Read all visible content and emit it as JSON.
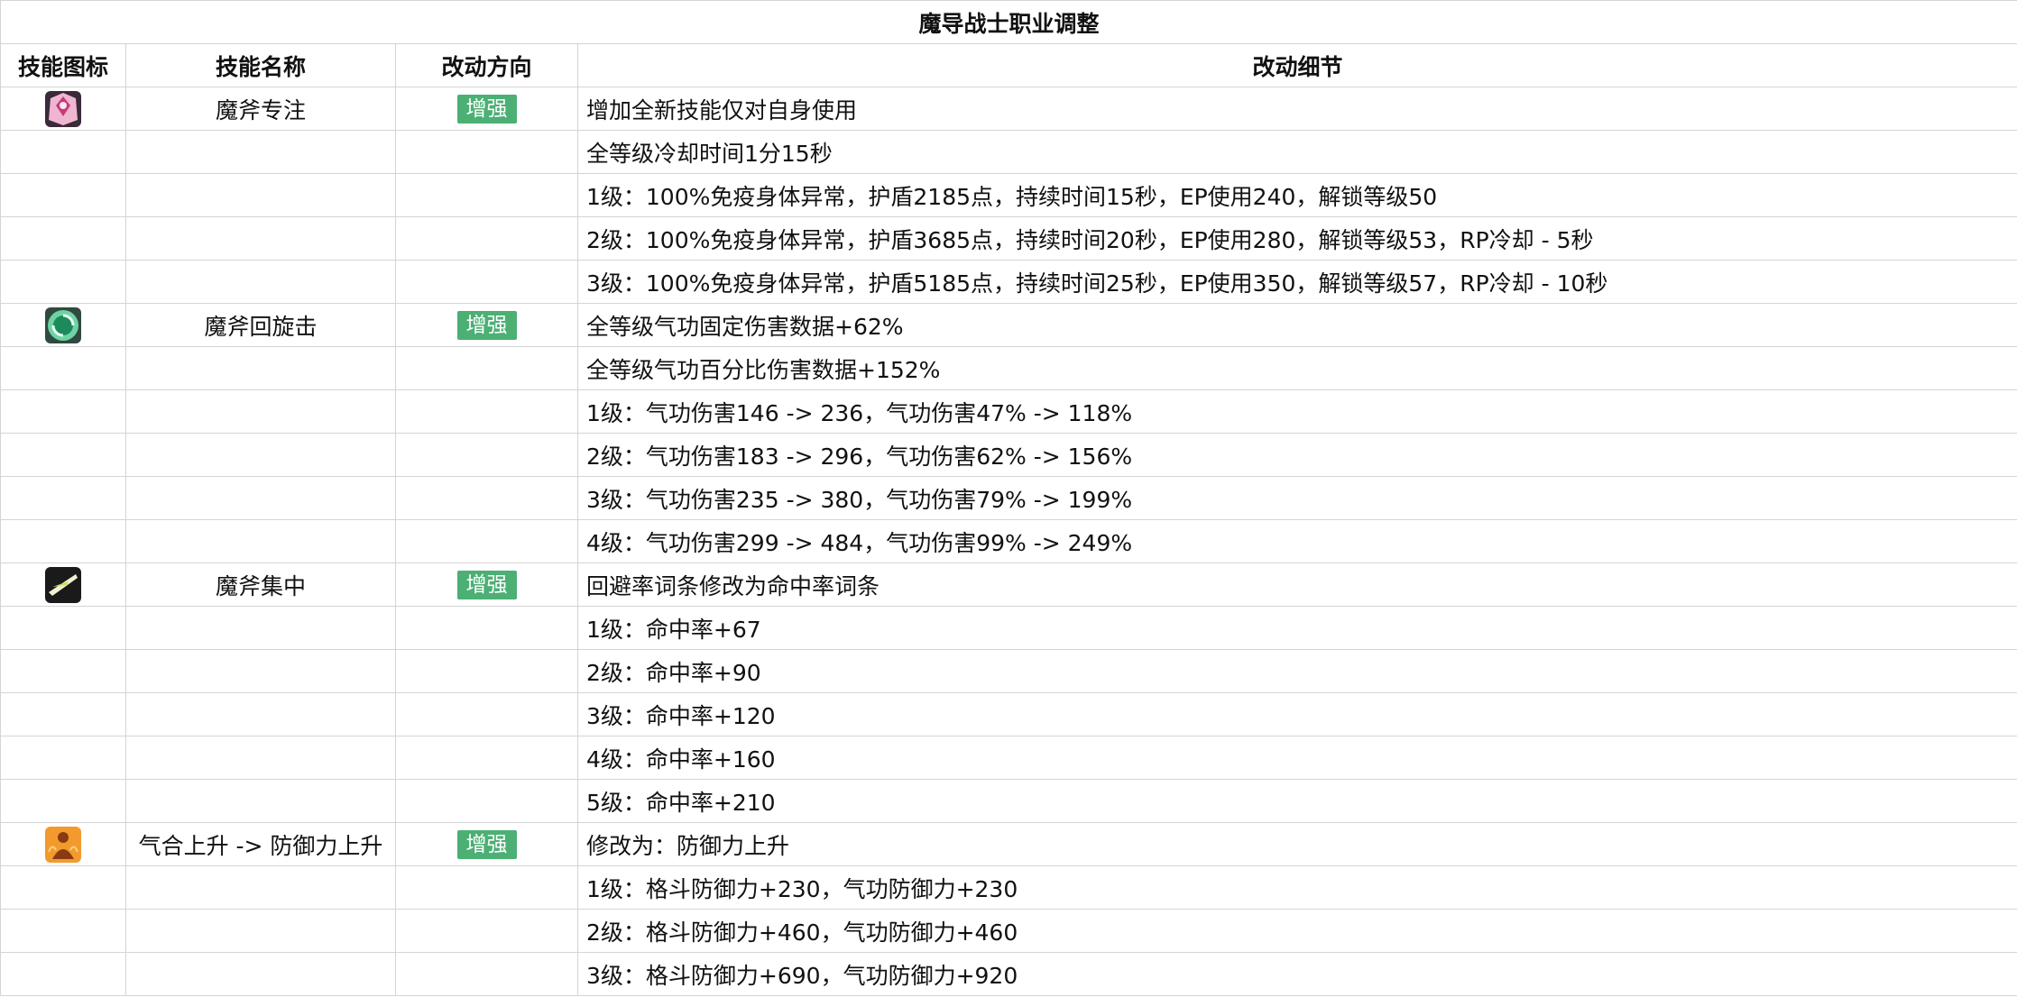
{
  "title": "魔导战士职业调整",
  "headers": {
    "icon": "技能图标",
    "name": "技能名称",
    "direction": "改动方向",
    "detail": "改动细节"
  },
  "skills": [
    {
      "icon": "pink-gem-icon",
      "name": "魔斧专注",
      "direction": "增强",
      "details": [
        "增加全新技能仅对自身使用",
        "全等级冷却时间1分15秒",
        "1级：100%免疫身体异常，护盾2185点，持续时间15秒，EP使用240，解锁等级50",
        "2级：100%免疫身体异常，护盾3685点，持续时间20秒，EP使用280，解锁等级53，RP冷却 - 5秒",
        "3级：100%免疫身体异常，护盾5185点，持续时间25秒，EP使用350，解锁等级57，RP冷却 - 10秒"
      ]
    },
    {
      "icon": "green-spiral-icon",
      "name": "魔斧回旋击",
      "direction": "增强",
      "details": [
        "全等级气功固定伤害数据+62%",
        "全等级气功百分比伤害数据+152%",
        "1级：气功伤害146 -> 236，气功伤害47% -> 118%",
        "2级：气功伤害183 -> 296，气功伤害62% -> 156%",
        "3级：气功伤害235 -> 380，气功伤害79% -> 199%",
        "4级：气功伤害299 -> 484，气功伤害99% -> 249%"
      ]
    },
    {
      "icon": "slash-icon",
      "name": "魔斧集中",
      "direction": "增强",
      "details": [
        "回避率词条修改为命中率词条",
        "1级：命中率+67",
        "2级：命中率+90",
        "3级：命中率+120",
        "4级：命中率+160",
        "5级：命中率+210"
      ]
    },
    {
      "icon": "fire-figure-icon",
      "name": "气合上升 -> 防御力上升",
      "direction": "增强",
      "details": [
        "修改为：防御力上升",
        "1级：格斗防御力+230，气功防御力+230",
        "2级：格斗防御力+460，气功防御力+460",
        "3级：格斗防御力+690，气功防御力+920"
      ]
    }
  ],
  "colors": {
    "badge": "#4caf74",
    "border": "#d4d4d4"
  }
}
